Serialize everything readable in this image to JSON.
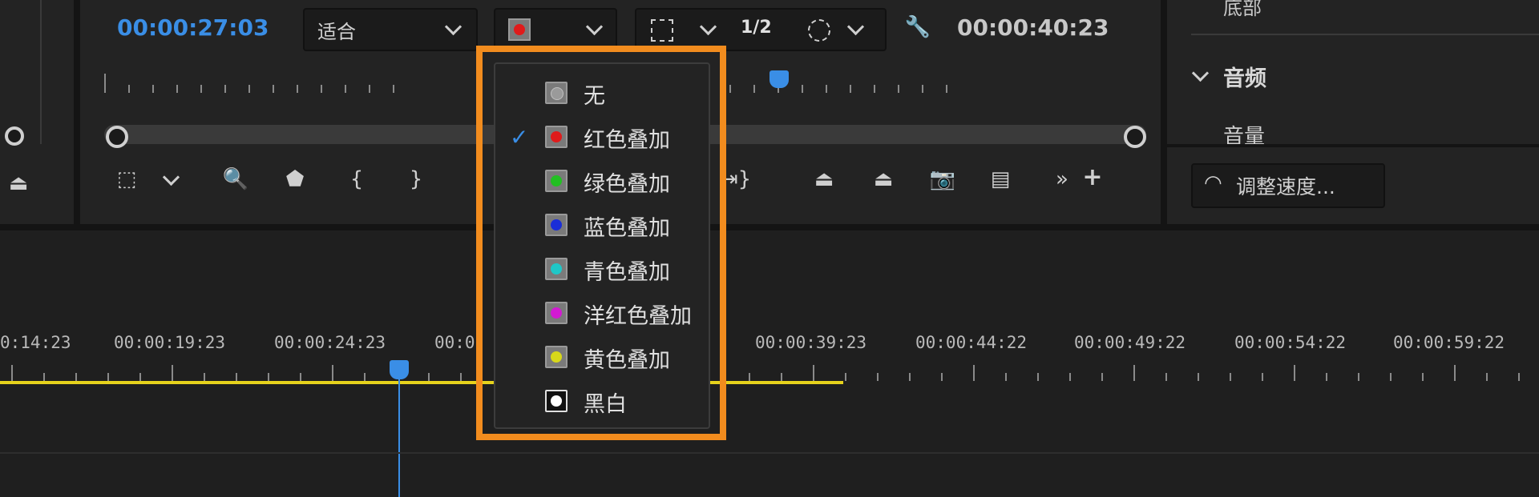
{
  "program_monitor": {
    "current_timecode": "00:00:27:03",
    "fit_dropdown": "适合",
    "resolution": "1/2",
    "duration_timecode": "00:00:40:23"
  },
  "overlay_menu": {
    "items": [
      {
        "label": "无",
        "checked": false,
        "color": "#9a9a9a"
      },
      {
        "label": "红色叠加",
        "checked": true,
        "color": "#e01b1b"
      },
      {
        "label": "绿色叠加",
        "checked": false,
        "color": "#22c022"
      },
      {
        "label": "蓝色叠加",
        "checked": false,
        "color": "#1a2ed8"
      },
      {
        "label": "青色叠加",
        "checked": false,
        "color": "#1fc7c7"
      },
      {
        "label": "洋红色叠加",
        "checked": false,
        "color": "#d21ad2"
      },
      {
        "label": "黄色叠加",
        "checked": false,
        "color": "#d8d81a"
      },
      {
        "label": "黑白",
        "checked": false,
        "color": "#ffffff"
      }
    ],
    "check_glyph": "✓"
  },
  "right_panel": {
    "top_partial_text": "底部",
    "audio_section": "音频",
    "volume_label": "音量",
    "speed_button": "调整速度..."
  },
  "timeline": {
    "ruler_labels": [
      "0:14:23",
      "00:00:19:23",
      "00:00:24:23",
      "00:0",
      "00:00:39:23",
      "00:00:44:22",
      "00:00:49:22",
      "00:00:54:22",
      "00:00:59:22"
    ]
  },
  "colors": {
    "accent_blue": "#3a8ee6",
    "highlight_orange": "#f28c1e",
    "work_area_yellow": "#e6d21c"
  }
}
